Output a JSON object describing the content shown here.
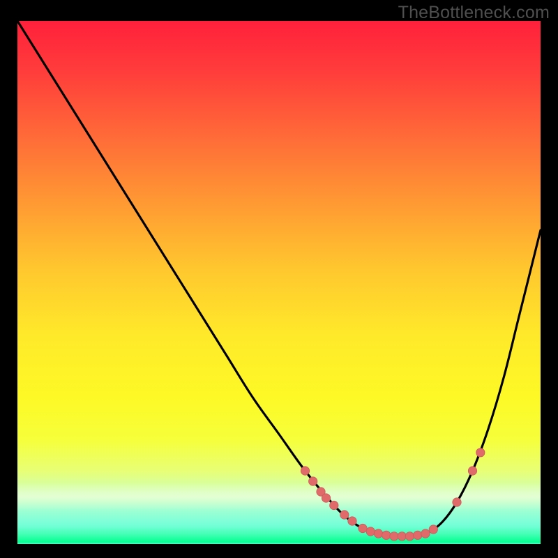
{
  "watermark": "TheBottleneck.com",
  "colors": {
    "background": "#000000",
    "curve": "#000000",
    "marker_fill": "#e06a6a",
    "marker_stroke": "#c95b5b"
  },
  "chart_data": {
    "type": "line",
    "title": "",
    "xlabel": "",
    "ylabel": "",
    "xlim": [
      0,
      100
    ],
    "ylim": [
      0,
      100
    ],
    "grid": false,
    "legend": false,
    "series": [
      {
        "name": "bottleneck-curve",
        "x": [
          0,
          5,
          10,
          15,
          20,
          25,
          30,
          35,
          40,
          45,
          50,
          55,
          60,
          63,
          66,
          69,
          72,
          75,
          78,
          81,
          84,
          87,
          90,
          93,
          96,
          100
        ],
        "y": [
          100,
          92,
          84,
          76,
          68,
          60,
          52,
          44,
          36,
          28,
          21,
          14,
          8,
          5,
          3,
          2,
          1.5,
          1.5,
          2,
          4,
          8,
          14,
          22,
          32,
          44,
          60
        ]
      }
    ],
    "markers": [
      {
        "x": 55.0,
        "y": 14.0
      },
      {
        "x": 56.5,
        "y": 12.0
      },
      {
        "x": 58.0,
        "y": 10.0
      },
      {
        "x": 59.0,
        "y": 8.8
      },
      {
        "x": 60.5,
        "y": 7.4
      },
      {
        "x": 62.5,
        "y": 5.6
      },
      {
        "x": 64.0,
        "y": 4.4
      },
      {
        "x": 66.0,
        "y": 3.0
      },
      {
        "x": 67.5,
        "y": 2.4
      },
      {
        "x": 69.0,
        "y": 2.0
      },
      {
        "x": 70.5,
        "y": 1.7
      },
      {
        "x": 72.0,
        "y": 1.5
      },
      {
        "x": 73.5,
        "y": 1.5
      },
      {
        "x": 75.0,
        "y": 1.5
      },
      {
        "x": 76.5,
        "y": 1.7
      },
      {
        "x": 78.0,
        "y": 2.0
      },
      {
        "x": 79.5,
        "y": 2.8
      },
      {
        "x": 84.0,
        "y": 8.0
      },
      {
        "x": 87.0,
        "y": 14.0
      },
      {
        "x": 88.5,
        "y": 17.5
      }
    ],
    "gradient_stops": [
      {
        "pos": 0,
        "color": "#ff203b"
      },
      {
        "pos": 10,
        "color": "#ff3e3b"
      },
      {
        "pos": 22,
        "color": "#ff6a38"
      },
      {
        "pos": 35,
        "color": "#ff9a33"
      },
      {
        "pos": 48,
        "color": "#ffc92e"
      },
      {
        "pos": 60,
        "color": "#ffe92a"
      },
      {
        "pos": 72,
        "color": "#fdf926"
      },
      {
        "pos": 80,
        "color": "#f6ff3a"
      },
      {
        "pos": 86,
        "color": "#e8ff75"
      },
      {
        "pos": 90,
        "color": "#cfffb3"
      },
      {
        "pos": 93,
        "color": "#a7ffd1"
      },
      {
        "pos": 96,
        "color": "#7affd9"
      },
      {
        "pos": 100,
        "color": "#37ffb7"
      }
    ]
  }
}
